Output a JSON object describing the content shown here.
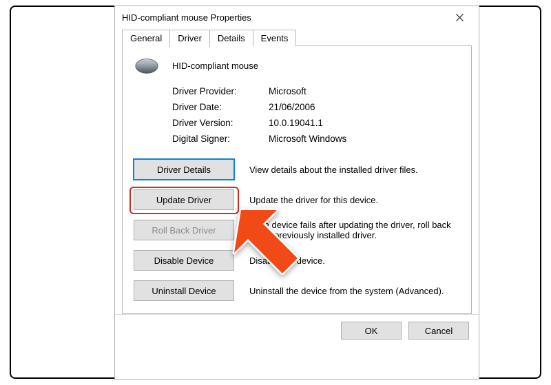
{
  "window": {
    "title": "HID-compliant mouse Properties"
  },
  "tabs": {
    "general": "General",
    "driver": "Driver",
    "details": "Details",
    "events": "Events",
    "active": "Driver"
  },
  "header": {
    "device_name": "HID-compliant mouse"
  },
  "info": {
    "provider_label": "Driver Provider:",
    "provider_value": "Microsoft",
    "date_label": "Driver Date:",
    "date_value": "21/06/2006",
    "version_label": "Driver Version:",
    "version_value": "10.0.19041.1",
    "signer_label": "Digital Signer:",
    "signer_value": "Microsoft Windows"
  },
  "actions": {
    "driver_details": {
      "label": "Driver Details",
      "desc": "View details about the installed driver files."
    },
    "update_driver": {
      "label": "Update Driver",
      "desc": "Update the driver for this device."
    },
    "roll_back": {
      "label": "Roll Back Driver",
      "desc": "If the device fails after updating the driver, roll back to the previously installed driver."
    },
    "disable": {
      "label": "Disable Device",
      "desc": "Disable the device."
    },
    "uninstall": {
      "label": "Uninstall Device",
      "desc": "Uninstall the device from the system (Advanced)."
    }
  },
  "footer": {
    "ok": "OK",
    "cancel": "Cancel"
  },
  "annotation": {
    "highlight_target": "update-driver-button",
    "arrow_color": "#f24a17"
  }
}
